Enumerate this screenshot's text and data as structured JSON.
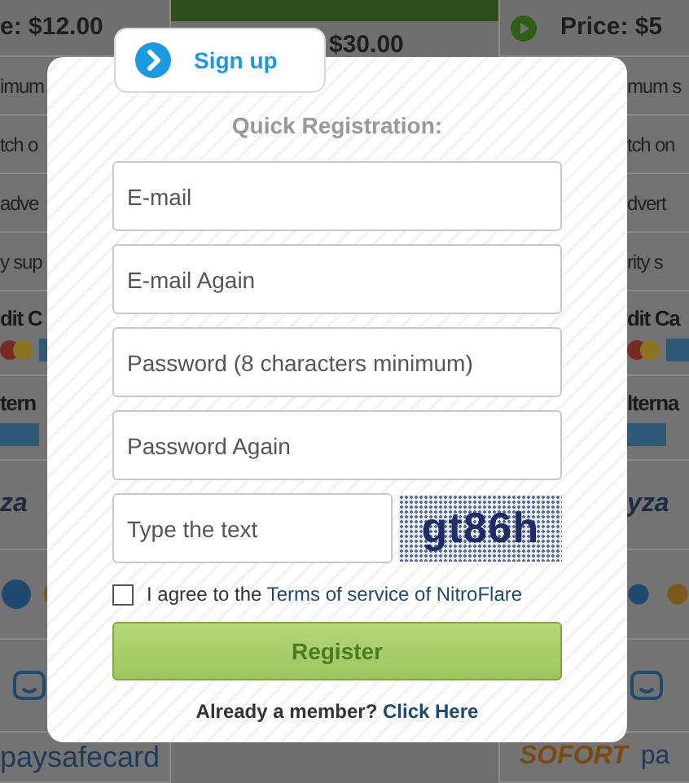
{
  "background": {
    "left_column": [
      {
        "kind": "price",
        "text": "e: $12.00"
      },
      {
        "kind": "feature",
        "text": "imum"
      },
      {
        "kind": "feature",
        "text": "tch o"
      },
      {
        "kind": "feature",
        "text": "adve"
      },
      {
        "kind": "feature",
        "text": "y sup"
      },
      {
        "kind": "cards_payment",
        "text": "dit C"
      },
      {
        "kind": "amex_payment",
        "text": "tern"
      },
      {
        "kind": "brand",
        "text": "za"
      },
      {
        "kind": "coins"
      },
      {
        "kind": "face"
      },
      {
        "kind": "footer",
        "text": "paysafecard"
      }
    ],
    "middle_column": {
      "price": "$30.00"
    },
    "right_column": [
      {
        "kind": "price",
        "text": "Price: $5"
      },
      {
        "kind": "feature",
        "text": "mum s"
      },
      {
        "kind": "feature",
        "text": "tch on"
      },
      {
        "kind": "feature",
        "text": "dvert"
      },
      {
        "kind": "feature",
        "text": "rity s"
      },
      {
        "kind": "cards_payment",
        "text": "dit Ca"
      },
      {
        "kind": "amex_payment",
        "text": "lterna"
      },
      {
        "kind": "brand",
        "text": "yza"
      },
      {
        "kind": "coins"
      },
      {
        "kind": "face"
      },
      {
        "kind": "footer",
        "text": "SOFORT",
        "extra": "pa"
      }
    ]
  },
  "dialog": {
    "tab": "Sign up",
    "title": "Quick Registration:",
    "fields": [
      {
        "placeholder": "E-mail"
      },
      {
        "placeholder": "E-mail Again"
      },
      {
        "placeholder": "Password (8 characters minimum)"
      },
      {
        "placeholder": "Password Again"
      }
    ],
    "captcha": {
      "placeholder": "Type the text",
      "image_text": "gt86h"
    },
    "terms": {
      "checked": false,
      "prefix": "I agree to the ",
      "link": "Terms of service of NitroFlare"
    },
    "register_button": "Register",
    "member": {
      "prefix": "Already a member? ",
      "link": "Click Here"
    }
  }
}
